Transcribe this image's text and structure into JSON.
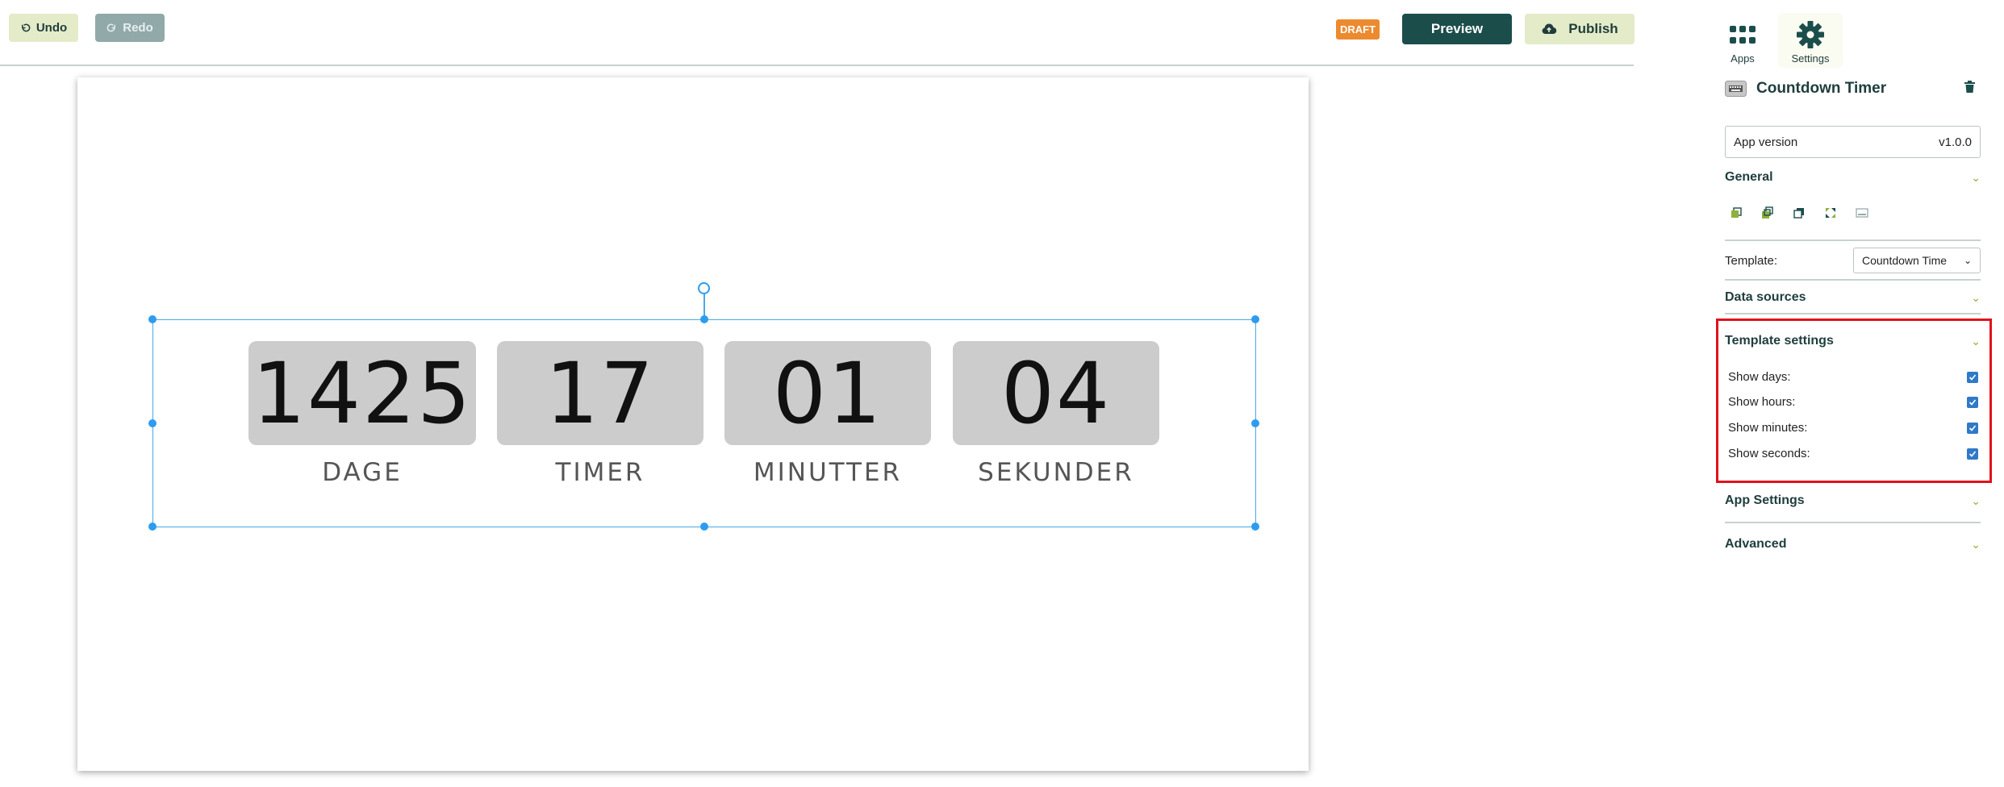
{
  "toolbar": {
    "undo_label": "Undo",
    "redo_label": "Redo",
    "status_badge": "DRAFT",
    "preview_label": "Preview",
    "publish_label": "Publish"
  },
  "countdown": {
    "units": [
      {
        "value": "1425",
        "label": "DAGE"
      },
      {
        "value": "17",
        "label": "TIMER"
      },
      {
        "value": "01",
        "label": "MINUTTER"
      },
      {
        "value": "04",
        "label": "SEKUNDER"
      }
    ]
  },
  "panel": {
    "tabs": [
      {
        "label": "Apps",
        "icon": "grid-icon"
      },
      {
        "label": "Settings",
        "icon": "gear-icon"
      }
    ],
    "app_title": "Countdown Timer",
    "version_label": "App version",
    "version_value": "v1.0.0",
    "sections": {
      "general": "General",
      "data_sources": "Data sources",
      "template_settings": "Template settings",
      "app_settings": "App Settings",
      "advanced": "Advanced"
    },
    "template_label": "Template:",
    "template_value": "Countdown Time",
    "checkboxes": [
      {
        "label": "Show days:",
        "checked": true
      },
      {
        "label": "Show hours:",
        "checked": true
      },
      {
        "label": "Show minutes:",
        "checked": true
      },
      {
        "label": "Show seconds:",
        "checked": true
      }
    ]
  },
  "colors": {
    "brand_dark": "#1b4d4b",
    "accent_light": "#e4ebc8",
    "draft": "#ec8a2f",
    "selection": "#2d9cf0",
    "highlight": "#e0121b"
  }
}
